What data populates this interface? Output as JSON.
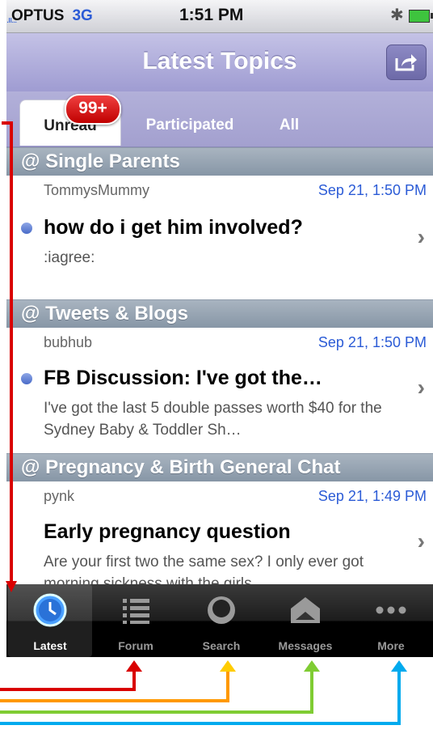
{
  "status_bar": {
    "carrier": "OPTUS",
    "network": "3G",
    "time": "1:51 PM"
  },
  "nav": {
    "title": "Latest Topics"
  },
  "segments": {
    "unread": "Unread",
    "participated": "Participated",
    "all": "All",
    "badge": "99+"
  },
  "sections": [
    {
      "name": "@ Single Parents",
      "author": "TommysMummy",
      "date": "Sep 21, 1:50 PM",
      "topic": "how do i get him involved?",
      "snippet": ":iagree:"
    },
    {
      "name": "@ Tweets & Blogs",
      "author": "bubhub",
      "date": "Sep 21, 1:50 PM",
      "topic": "FB Discussion:  I've got the…",
      "snippet": "I've got the last  5 double passes worth $40 for the Sydney Baby & Toddler Sh…"
    },
    {
      "name": "@ Pregnancy & Birth General Chat",
      "author": "pynk",
      "date": "Sep 21, 1:49 PM",
      "topic": "Early pregnancy question",
      "snippet": "Are your first two the same sex? I only ever got morning sickness with the girls…"
    }
  ],
  "tabbar": {
    "latest": "Latest",
    "forum": "Forum",
    "search": "Search",
    "messages": "Messages",
    "more": "More"
  },
  "colors": {
    "nav": "#a3a0cf",
    "arrow_red": "#d90000",
    "arrow_orange": "#ff9900",
    "arrow_yellow": "#ffcc00",
    "arrow_green": "#7fcc33",
    "arrow_blue": "#00aaee"
  }
}
